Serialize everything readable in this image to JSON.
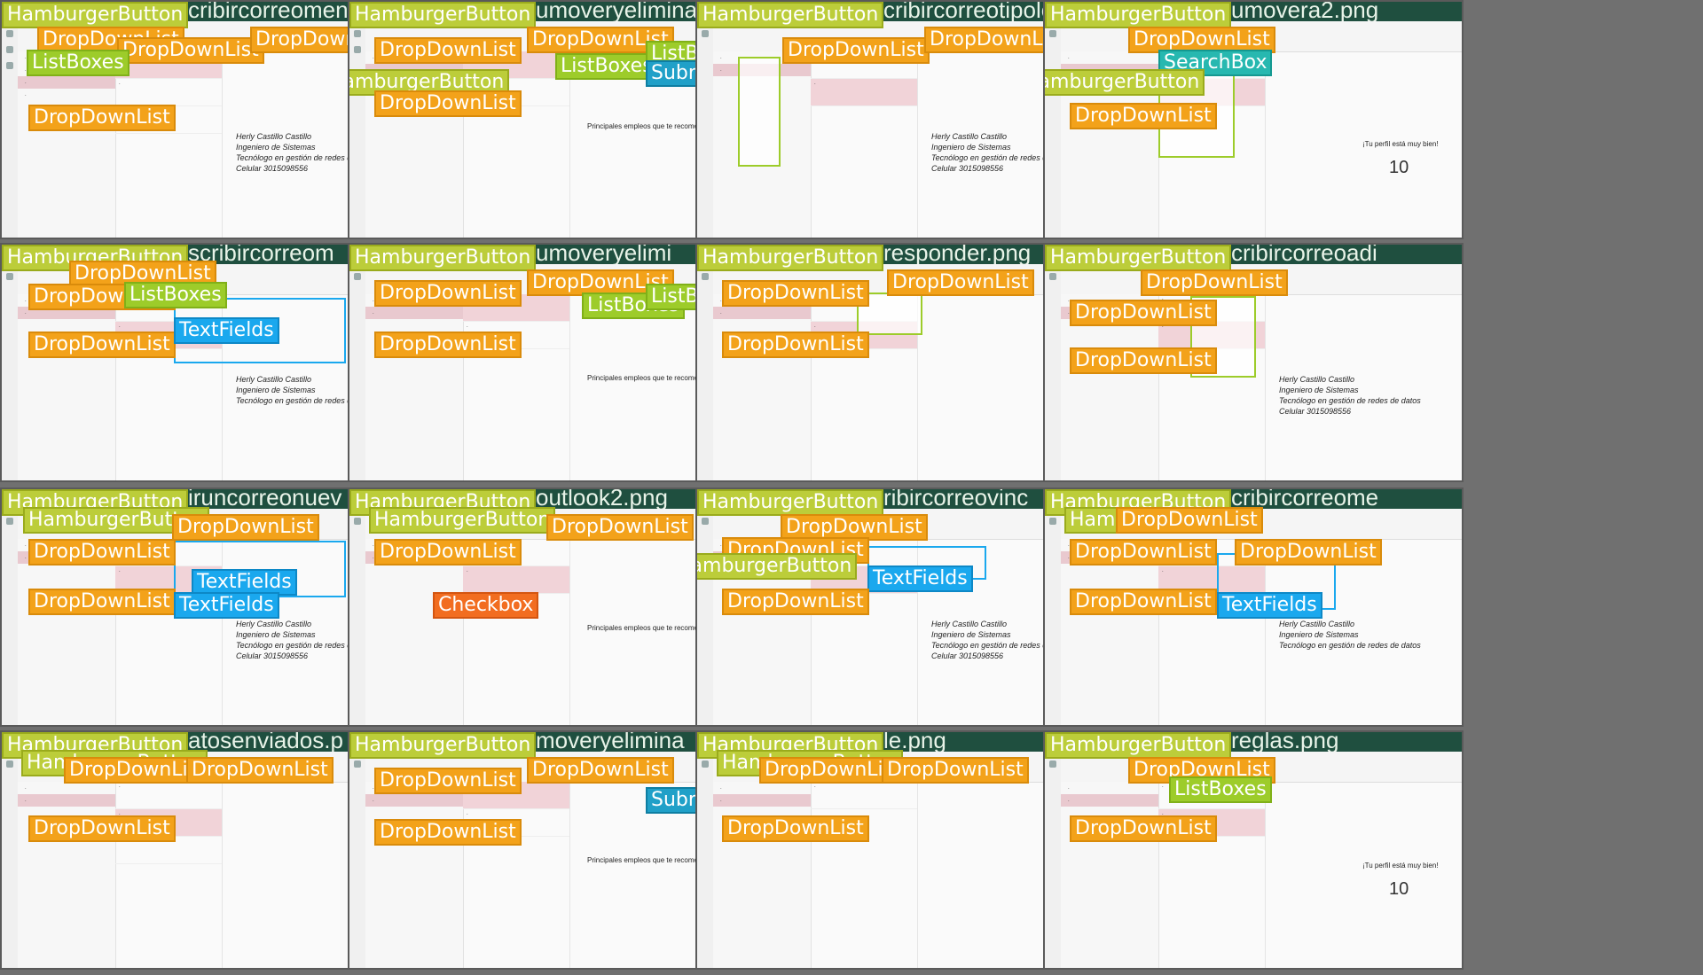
{
  "titles": [
    "cribircorreomenu",
    "umoveryelimina",
    "cribircorreotipole",
    "umovera2.png",
    "scribircorreom",
    "umoveryelimi",
    "responder.png",
    "cribircorreoadi",
    "iruncorreonuev",
    "outlook2.png",
    "ribircorreovinc",
    "cribircorreome",
    "atosenviados.p",
    "moveryelimina",
    "le.png",
    "reglas.png"
  ],
  "labels": {
    "hamburger": "HamburgerButton",
    "dropdown": "DropDownList",
    "listboxes": "ListBoxes",
    "textfields": "TextFields",
    "submenu": "Submenu",
    "searchbox": "SearchBox",
    "checkbox": "Checkbox"
  },
  "email": {
    "signature_name": "Herly Castillo Castillo",
    "signature_role": "Ingeniero de Sistemas",
    "signature_degree": "Tecnólogo en gestión de redes de datos",
    "signature_phone": "Celular 3015098556"
  },
  "linkedin": {
    "headline": "Principales empleos que te recomendamos",
    "profile_title": "¡Tu perfil está muy bien!",
    "views": "10"
  },
  "colors": {
    "hamburger": "#bccd3a",
    "dropdown": "#f3a21a",
    "listboxes": "#9dcc2a",
    "textfields": "#1aa8ee",
    "submenu": "#20a0c8",
    "searchbox": "#27b8b0",
    "checkbox": "#f26d20"
  }
}
